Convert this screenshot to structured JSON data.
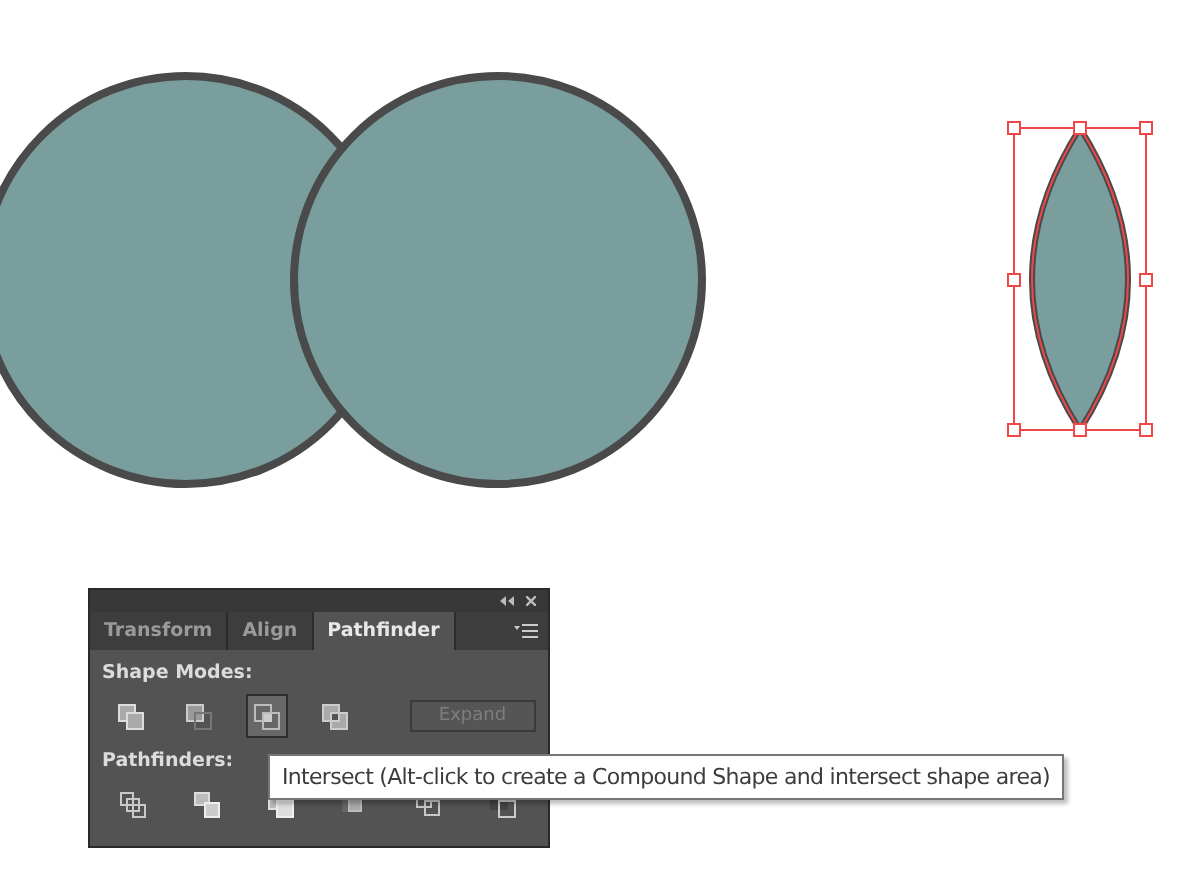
{
  "artboard": {
    "selection": {
      "selected": true
    }
  },
  "panel": {
    "tabs": [
      {
        "label": "Transform",
        "selected": false
      },
      {
        "label": "Align",
        "selected": false
      },
      {
        "label": "Pathfinder",
        "selected": true
      }
    ],
    "shape_modes": {
      "label": "Shape Modes:",
      "buttons": [
        {
          "kind": "unite",
          "selected": false
        },
        {
          "kind": "minus-front",
          "selected": false
        },
        {
          "kind": "intersect",
          "selected": true
        },
        {
          "kind": "exclude",
          "selected": false
        }
      ],
      "expand": {
        "label": "Expand",
        "disabled": true
      }
    },
    "pathfinders": {
      "label": "Pathfinders:",
      "buttons": [
        {
          "kind": "divide"
        },
        {
          "kind": "trim"
        },
        {
          "kind": "merge"
        },
        {
          "kind": "crop"
        },
        {
          "kind": "outline"
        },
        {
          "kind": "minus-back"
        }
      ]
    }
  },
  "tooltip": {
    "text": "Intersect (Alt-click to create a Compound Shape and intersect shape area)"
  }
}
